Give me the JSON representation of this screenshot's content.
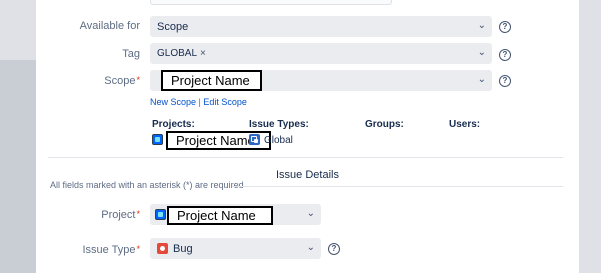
{
  "form": {
    "available_for": {
      "label": "Available for",
      "value": "Scope"
    },
    "tag": {
      "label": "Tag",
      "chip": "GLOBAL",
      "chip_remove": "×"
    },
    "scope": {
      "label": "Scope",
      "required_mark": "*",
      "value": "Project Name"
    },
    "scope_links": {
      "new_scope": "New Scope",
      "separator": "|",
      "edit_scope": "Edit Scope"
    },
    "scope_table": {
      "headers": {
        "projects": "Projects:",
        "issue_types": "Issue Types:",
        "groups": "Groups:",
        "users": "Users:"
      },
      "project_value": "Project Name",
      "issue_type_value": "Global"
    },
    "help_glyph": "?",
    "chevron_glyph": "⌄"
  },
  "issue_details": {
    "title": "Issue Details",
    "note": "All fields marked with an asterisk (*) are required",
    "project": {
      "label": "Project",
      "required_mark": "*",
      "value": "Project Name"
    },
    "issue_type": {
      "label": "Issue Type",
      "required_mark": "*",
      "value": "Bug"
    }
  },
  "icons": {
    "project": "project-avatar-icon",
    "global": "global-issue-type-icon",
    "bug": "bug-icon",
    "help": "help-icon",
    "chevron": "chevron-down-icon"
  },
  "colors": {
    "page_bg": "#dfe1e6",
    "panel_bg": "#ffffff",
    "select_bg": "#ebecf0",
    "link": "#0052cc",
    "required": "#de350b",
    "bug": "#e5493a",
    "project_avatar": "#0065ff"
  }
}
